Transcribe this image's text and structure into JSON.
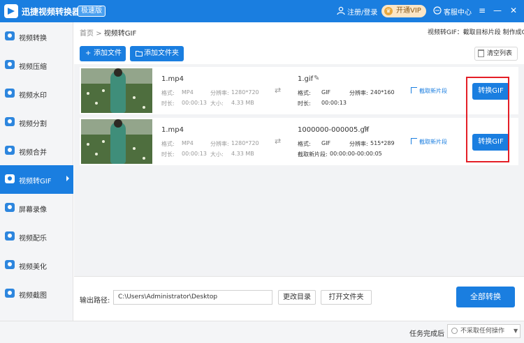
{
  "app": {
    "title": "迅捷视频转换器",
    "edition": "极速版",
    "login": "注册/登录",
    "vip": "开通VIP",
    "service": "客服中心",
    "window_menu": "≡",
    "window_min": "—",
    "window_max": "□",
    "window_close": "✕"
  },
  "sidebar": {
    "items": [
      {
        "label": "视频转换"
      },
      {
        "label": "视频压缩"
      },
      {
        "label": "视频水印"
      },
      {
        "label": "视频分割"
      },
      {
        "label": "视频合并"
      },
      {
        "label": "视频转GIF"
      },
      {
        "label": "屏幕录像"
      },
      {
        "label": "视频配乐"
      },
      {
        "label": "视频美化"
      },
      {
        "label": "视频截图"
      }
    ],
    "active_index": 5
  },
  "breadcrumb": {
    "home": "首页",
    "sep": ">",
    "current": "视频转GIF"
  },
  "hint": "视频转GIF：截取目标片段 制作成GIF",
  "toolbar": {
    "add_file": "添加文件",
    "add_folder": "添加文件夹",
    "clear_list": "清空列表"
  },
  "labels": {
    "format": "格式:",
    "resolution": "分辨率:",
    "duration": "时长:",
    "size": "大小:",
    "clip_range": "截取新片段:",
    "clip_button": "截取新片段",
    "convert_button": "转换GIF"
  },
  "files": [
    {
      "src_name": "1.mp4",
      "src_format": "MP4",
      "src_resolution": "1280*720",
      "src_duration": "00:00:13",
      "src_size": "4.33 MB",
      "out_name": "1.gif",
      "out_format": "GIF",
      "out_resolution": "240*160",
      "out_duration": "00:00:13"
    },
    {
      "src_name": "1.mp4",
      "src_format": "MP4",
      "src_resolution": "1280*720",
      "src_duration": "00:00:13",
      "src_size": "4.33 MB",
      "out_name": "1000000-000005.gif",
      "out_format": "GIF",
      "out_resolution": "515*289",
      "out_clip": "00:00:00-00:00:05"
    }
  ],
  "footer": {
    "output_label": "输出路径:",
    "output_path": "C:\\Users\\Administrator\\Desktop",
    "change_dir": "更改目录",
    "open_folder": "打开文件夹",
    "convert_all": "全部转换"
  },
  "status": {
    "done_label": "任务完成后",
    "done_option": "不采取任何操作"
  },
  "colors": {
    "accent": "#1a7ee0",
    "highlight_box": "#e41e26"
  }
}
